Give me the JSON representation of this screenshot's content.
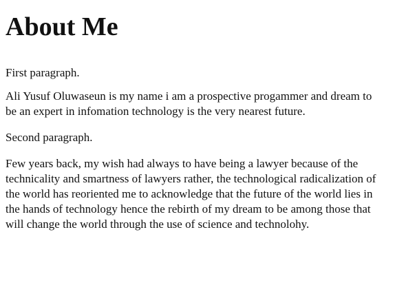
{
  "page": {
    "title": "About Me",
    "paragraphs": [
      "First paragraph.",
      "Ali Yusuf Oluwaseun is my name i am a prospective progammer and dream to be an expert in infomation technology is the very nearest future.",
      "Second paragraph.",
      "Few years back, my wish had always to have being a lawyer because of the technicality and smartness of lawyers rather, the technological radicalization of the world has reoriented me to acknowledge that the future of the world lies in the hands of technology hence the rebirth of my dream to be among those that will change the world through the use of science and technolohy."
    ]
  }
}
